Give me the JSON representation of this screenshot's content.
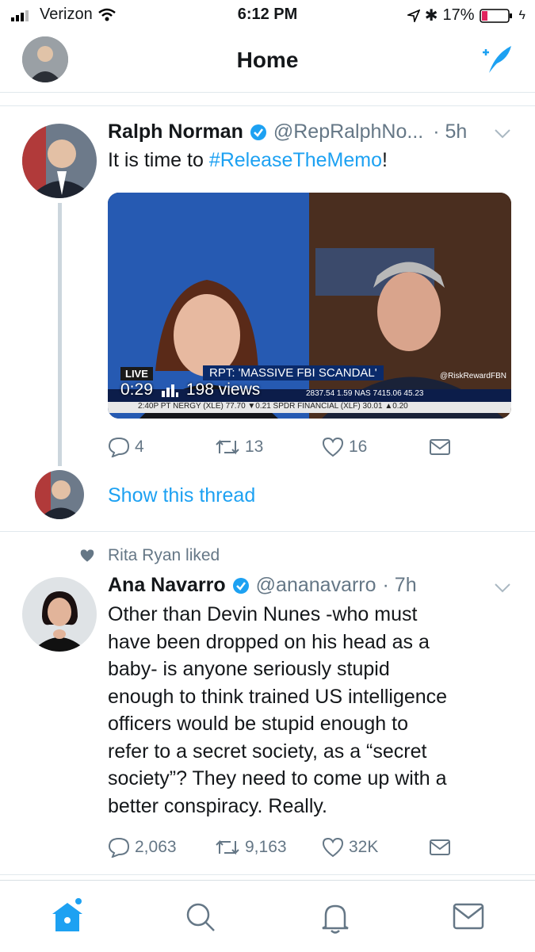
{
  "status": {
    "carrier": "Verizon",
    "time": "6:12 PM",
    "battery": "17%"
  },
  "nav": {
    "title": "Home"
  },
  "tweets": [
    {
      "name": "Ralph Norman",
      "handle": "@RepRalphNo...",
      "time": "· 5h",
      "text_before": "It is time to ",
      "hashtag": "#ReleaseTheMemo",
      "text_after": "!",
      "video": {
        "duration": "0:29",
        "views": "198 views",
        "live": "LIVE",
        "headline": "RPT: 'MASSIVE FBI SCANDAL'",
        "ticker1": "2837.54   1.59  NAS  7415.06  45.23",
        "ticker2": "2:40P PT  NERGY (XLE) 77.70 ▼0.21   SPDR FINANCIAL (XLF) 30.01 ▲0.20",
        "watermark": "@RiskRewardFBN"
      },
      "replies": "4",
      "retweets": "13",
      "likes": "16",
      "show_thread": "Show this thread"
    },
    {
      "social": "Rita Ryan liked",
      "name": "Ana Navarro",
      "handle": "@ananavarro",
      "time": "· 7h",
      "lines": [
        "Other than Devin Nunes -who must",
        "have been dropped on his head as a",
        "baby- is anyone seriously stupid",
        "enough to think trained US intelligence",
        "officers would be stupid enough to",
        "refer to a secret society, as a “secret",
        "society”? They need to come up with a",
        "better conspiracy. Really."
      ],
      "replies": "2,063",
      "retweets": "9,163",
      "likes": "32K"
    }
  ],
  "colors": {
    "accent": "#1da1f2",
    "muted": "#657786",
    "battery_low": "#e0245e"
  }
}
